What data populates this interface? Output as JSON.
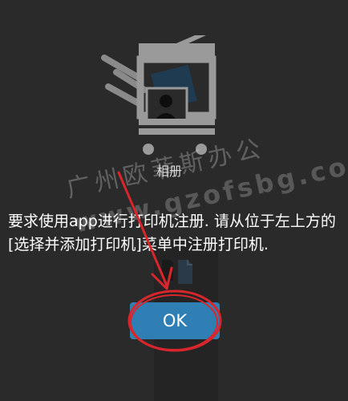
{
  "background_label": "相册",
  "watermark": {
    "line1": "广州欧菲斯办公",
    "line2": "www.gzofsbg.com"
  },
  "dialog": {
    "message": "要求使用app进行打印机注册. 请从位于左上方的[选择并添加打印机]菜单中注册打印机.",
    "ok_label": "OK"
  },
  "colors": {
    "background": "#2a2a2a",
    "button": "#2f7eb4",
    "annotation": "#d9262c",
    "text": "#ffffff"
  },
  "icons": [
    "printer-icon",
    "photo-icon",
    "document-icon"
  ]
}
